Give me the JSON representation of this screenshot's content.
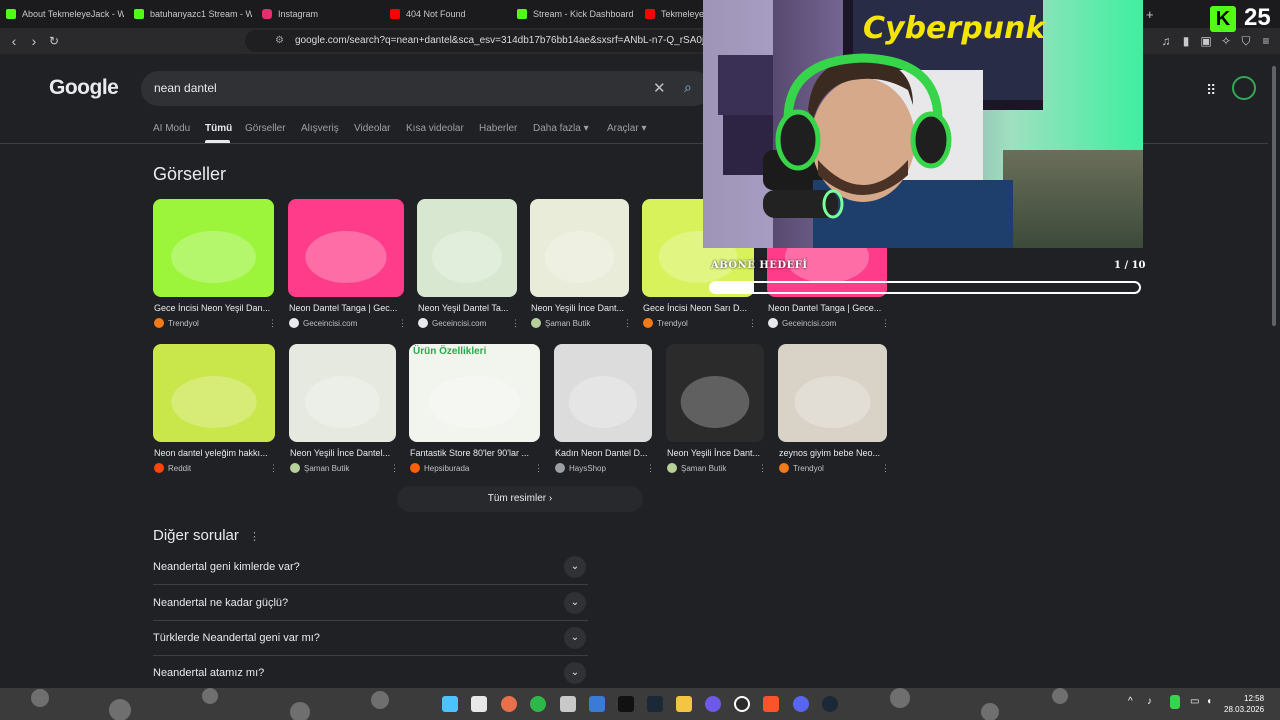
{
  "browser": {
    "tabs": [
      {
        "title": "About TekmeleyeJack - W",
        "favicon_color": "#53fc18"
      },
      {
        "title": "batuhanyazc1 Stream - W",
        "favicon_color": "#53fc18"
      },
      {
        "title": "Instagram",
        "favicon_color": "#e1306c"
      },
      {
        "title": "404 Not Found",
        "favicon_color": "#ff0000"
      },
      {
        "title": "Stream - Kick Dashboard",
        "favicon_color": "#53fc18"
      },
      {
        "title": "TekmeleyeJa",
        "favicon_color": "#ff0000"
      }
    ],
    "url": "google.com/search?q=nean+dantel&sca_esv=314db17b76bb14ae&sxsrf=ANbL-n7-Q_rSA0jteDHm"
  },
  "google": {
    "logo": "Google",
    "query": "nean dantel",
    "tabs": [
      "AI Modu",
      "Tümü",
      "Görseller",
      "Alışveriş",
      "Videolar",
      "Kısa videolar",
      "Haberler",
      "Daha fazla ▾",
      "Araçlar ▾"
    ],
    "active_tab": "Tümü",
    "images_section_title": "Görseller",
    "image_results_row1": [
      {
        "caption": "Gece İncisi Neon Yeşil Dan...",
        "source": "Trendyol",
        "icon_color": "#f27a1a",
        "thumb_color": "#9cf53b"
      },
      {
        "caption": "Neon Dantel Tanga | Gec...",
        "source": "Geceincisi.com",
        "icon_color": "#e8eaed",
        "thumb_color": "#ff3c8a"
      },
      {
        "caption": "Neon Yeşil Dantel Ta...",
        "source": "Geceincisi.com",
        "icon_color": "#e8eaed",
        "thumb_color": "#d8e8d0"
      },
      {
        "caption": "Neon Yeşili İnce Dant...",
        "source": "Şaman Butik",
        "icon_color": "#b6d29a",
        "thumb_color": "#e8ecd8"
      },
      {
        "caption": "Gece İncisi Neon Sarı D...",
        "source": "Trendyol",
        "icon_color": "#f27a1a",
        "thumb_color": "#d7f25a"
      },
      {
        "caption": "Neon Dantel Tanga | Gece...",
        "source": "Geceincisi.com",
        "icon_color": "#e8eaed",
        "thumb_color": "#ff3c8a"
      }
    ],
    "image_results_row2": [
      {
        "caption": "Neon dantel yeleğim hakkı...",
        "source": "Reddit",
        "icon_color": "#ff4500",
        "thumb_color": "#c9e64a"
      },
      {
        "caption": "Neon Yeşili İnce Dantel...",
        "source": "Şaman Butik",
        "icon_color": "#b6d29a",
        "thumb_color": "#e6e9e0"
      },
      {
        "caption": "Fantastik Store 80'ler 90'lar ...",
        "source": "Hepsiburada",
        "icon_color": "#ff6000",
        "thumb_color": "#f2f5ee"
      },
      {
        "caption": "Kadın Neon Dantel D...",
        "source": "HaysShop",
        "icon_color": "#9aa0a6",
        "thumb_color": "#dcdcdc"
      },
      {
        "caption": "Neon Yeşili İnce Dant...",
        "source": "Şaman Butik",
        "icon_color": "#b6d29a",
        "thumb_color": "#2b2b2b"
      },
      {
        "caption": "zeynos giyim bebe Neo...",
        "source": "Trendyol",
        "icon_color": "#f27a1a",
        "thumb_color": "#d9d3c7"
      }
    ],
    "row2_overlay_text": "Ürün Özellikleri",
    "all_images_button": "Tüm resimler",
    "paa_title": "Diğer sorular",
    "paa_questions": [
      "Neandertal geni kimlerde var?",
      "Neandertal ne kadar güçlü?",
      "Türklerde Neandertal geni var mı?",
      "Neandertal atamız mı?"
    ]
  },
  "stream_overlay": {
    "follower_count": "25",
    "kick_logo": "K",
    "goal_label": "ABONE HEDEFİ",
    "goal_progress": "1 / 10",
    "goal_fraction": 0.1,
    "poster_text": "Cyberpunk"
  },
  "taskbar": {
    "time": "12:58",
    "date": "28.03.2026"
  }
}
